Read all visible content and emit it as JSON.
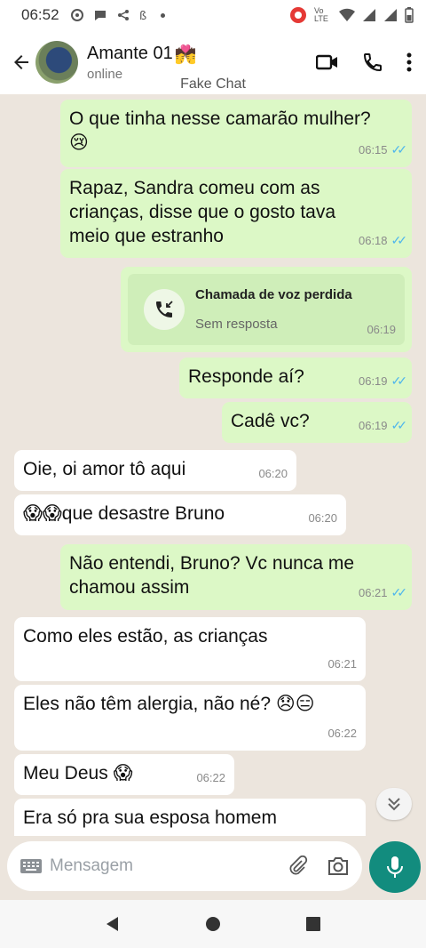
{
  "status_bar": {
    "time": "06:52",
    "network": "Vo LTE"
  },
  "header": {
    "contact_name": "Amante 01",
    "contact_emoji": "💏",
    "status": "online",
    "subtitle": "Fake Chat"
  },
  "messages": [
    {
      "dir": "out",
      "text": "O que tinha nesse camarão mulher?",
      "emoji": "😢",
      "time": "06:15",
      "read": true
    },
    {
      "dir": "out",
      "text": "Rapaz, Sandra comeu com as crianças, disse que o gosto tava meio que estranho",
      "time": "06:18",
      "read": true
    },
    {
      "dir": "call",
      "title": "Chamada de voz perdida",
      "subtitle": "Sem resposta",
      "time": "06:19"
    },
    {
      "dir": "out",
      "text": "Responde aí?",
      "time": "06:19",
      "read": true
    },
    {
      "dir": "out",
      "text": "Cadê vc?",
      "time": "06:19",
      "read": true
    },
    {
      "dir": "in",
      "text": "Oie, oi amor tô aqui",
      "time": "06:20"
    },
    {
      "dir": "in",
      "emoji": "😱😱",
      "text": "que desastre Bruno",
      "time": "06:20"
    },
    {
      "dir": "out",
      "text": "Não entendi, Bruno? Vc nunca me chamou assim",
      "time": "06:21",
      "read": true
    },
    {
      "dir": "in",
      "text": "Como eles estão, as crianças",
      "time": "06:21"
    },
    {
      "dir": "in",
      "text": "Eles não têm alergia, não  né?",
      "emoji": "😞😑",
      "time": "06:22"
    },
    {
      "dir": "in",
      "text": "Meu Deus",
      "emoji": "😱",
      "time": "06:22"
    },
    {
      "dir": "in",
      "text": "Era só pra sua esposa homem",
      "time": ""
    }
  ],
  "composer": {
    "placeholder": "Mensagem"
  },
  "colors": {
    "outgoing_bubble": "#dcf8c6",
    "incoming_bubble": "#ffffff",
    "chat_background": "#ece5dd",
    "accent": "#128c7e",
    "read_ticks": "#4fb6ec"
  }
}
